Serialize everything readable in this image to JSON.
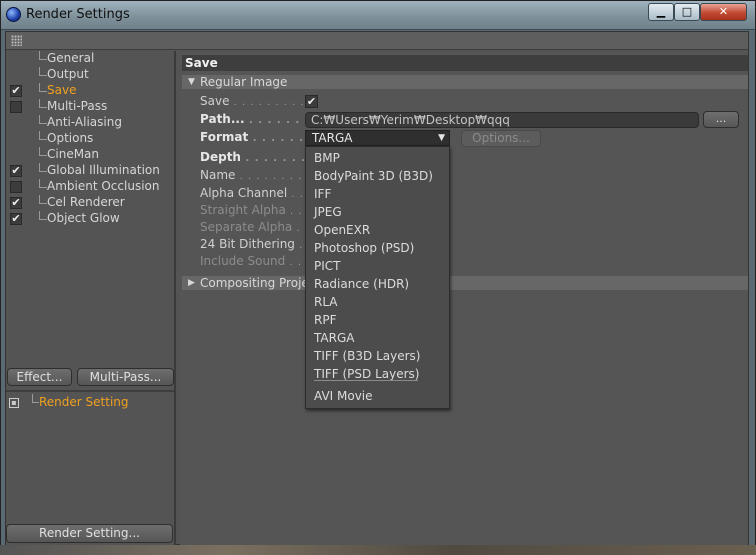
{
  "window": {
    "title": "Render Settings",
    "controls": {
      "minimize": "▁",
      "maximize": "□",
      "close": "✕"
    }
  },
  "sidebar": {
    "items": [
      {
        "label": "General",
        "checkbox": false,
        "checked": false
      },
      {
        "label": "Output",
        "checkbox": false,
        "checked": false
      },
      {
        "label": "Save",
        "checkbox": true,
        "checked": true,
        "active": true
      },
      {
        "label": "Multi-Pass",
        "checkbox": true,
        "checked": false
      },
      {
        "label": "Anti-Aliasing",
        "checkbox": false,
        "checked": false
      },
      {
        "label": "Options",
        "checkbox": false,
        "checked": false
      },
      {
        "label": "CineMan",
        "checkbox": false,
        "checked": false
      },
      {
        "label": "Global Illumination",
        "checkbox": true,
        "checked": true
      },
      {
        "label": "Ambient Occlusion",
        "checkbox": true,
        "checked": false
      },
      {
        "label": "Cel Renderer",
        "checkbox": true,
        "checked": true
      },
      {
        "label": "Object Glow",
        "checkbox": true,
        "checked": true
      }
    ],
    "effect_button": "Effect...",
    "multipass_button": "Multi-Pass...",
    "render_setting_item": "Render Setting",
    "render_setting_button": "Render Setting..."
  },
  "main": {
    "section_title": "Save",
    "regular_image_group": "Regular Image",
    "compositing_group": "Compositing Proje",
    "params": {
      "save_label": "Save",
      "path_label": "Path...",
      "format_label": "Format",
      "depth_label": "Depth",
      "name_label": "Name",
      "alpha_channel_label": "Alpha Channel",
      "straight_alpha_label": "Straight Alpha",
      "separate_alpha_label": "Separate Alpha",
      "dithering_label": "24 Bit Dithering",
      "include_sound_label": "Include Sound"
    },
    "save_checked": true,
    "path_value": "C:₩Users₩Yerim₩Desktop₩qqq",
    "browse_button": "...",
    "format_value": "TARGA",
    "options_button": "Options...",
    "format_options": [
      "BMP",
      "BodyPaint 3D (B3D)",
      "IFF",
      "JPEG",
      "OpenEXR",
      "Photoshop (PSD)",
      "PICT",
      "Radiance (HDR)",
      "RLA",
      "RPF",
      "TARGA",
      "TIFF (B3D Layers)",
      "TIFF (PSD Layers)",
      "AVI Movie"
    ]
  }
}
